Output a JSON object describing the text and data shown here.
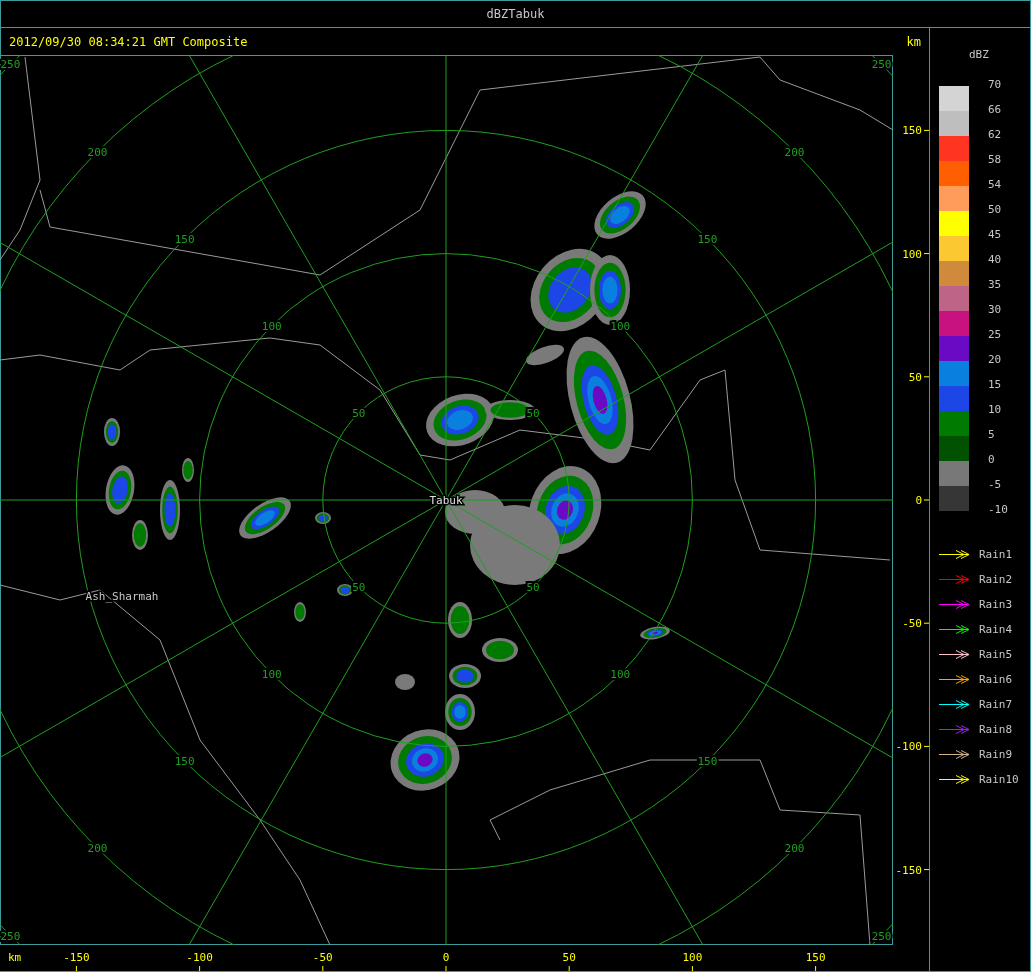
{
  "window": {
    "title": "dBZTabuk"
  },
  "header": {
    "timestamp": "2012/09/30 08:34:21 GMT Composite",
    "unit": "km"
  },
  "map": {
    "range_rings": [
      {
        "labels": [
          "50",
          "50",
          "50",
          "50"
        ]
      },
      {
        "labels": [
          "100",
          "100",
          "100",
          "100"
        ]
      },
      {
        "labels": [
          "150",
          "150",
          "150",
          "150"
        ]
      },
      {
        "labels": [
          "200",
          "200",
          "200",
          "200"
        ]
      },
      {
        "labels": [
          "250",
          "250",
          "250",
          "250"
        ]
      }
    ],
    "places": [
      "Tabuk",
      "Ash_Sharmah"
    ]
  },
  "y_axis": {
    "ticks": [
      "150",
      "100",
      "50",
      "0",
      "-50",
      "-100",
      "-150"
    ]
  },
  "x_axis": {
    "unit": "km",
    "ticks": [
      "-150",
      "-100",
      "-50",
      "0",
      "50",
      "100",
      "150"
    ]
  },
  "legend": {
    "title": "dBZ",
    "levels": [
      {
        "label": "70",
        "color": "#d4d4d4"
      },
      {
        "label": "66",
        "color": "#bebebe"
      },
      {
        "label": "62",
        "color": "#ff3522"
      },
      {
        "label": "58",
        "color": "#ff5f00"
      },
      {
        "label": "54",
        "color": "#ff9c5a"
      },
      {
        "label": "50",
        "color": "#ffff00"
      },
      {
        "label": "45",
        "color": "#fcc832"
      },
      {
        "label": "40",
        "color": "#d08a3c"
      },
      {
        "label": "35",
        "color": "#be6487"
      },
      {
        "label": "30",
        "color": "#c8127f"
      },
      {
        "label": "25",
        "color": "#6a0ac4"
      },
      {
        "label": "20",
        "color": "#0a80de"
      },
      {
        "label": "15",
        "color": "#1c46e6"
      },
      {
        "label": "10",
        "color": "#007a00"
      },
      {
        "label": "5",
        "color": "#005200"
      },
      {
        "label": "0",
        "color": "#787878"
      },
      {
        "label": "-5",
        "color": "#363636"
      }
    ],
    "bottom_label": "-10"
  },
  "tracks": [
    {
      "label": "Rain1",
      "color": "#ffff00"
    },
    {
      "label": "Rain2",
      "color": "#ff0000"
    },
    {
      "label": "Rain3",
      "color": "#ff00ff"
    },
    {
      "label": "Rain4",
      "color": "#00ff00"
    },
    {
      "label": "Rain5",
      "color": "#ffc0cb"
    },
    {
      "label": "Rain6",
      "color": "#ffa500"
    },
    {
      "label": "Rain7",
      "color": "#00ffff"
    },
    {
      "label": "Rain8",
      "color": "#a020f0"
    },
    {
      "label": "Rain9",
      "color": "#d2b48c"
    },
    {
      "label": "Rain10",
      "color": "#ffff00"
    }
  ]
}
